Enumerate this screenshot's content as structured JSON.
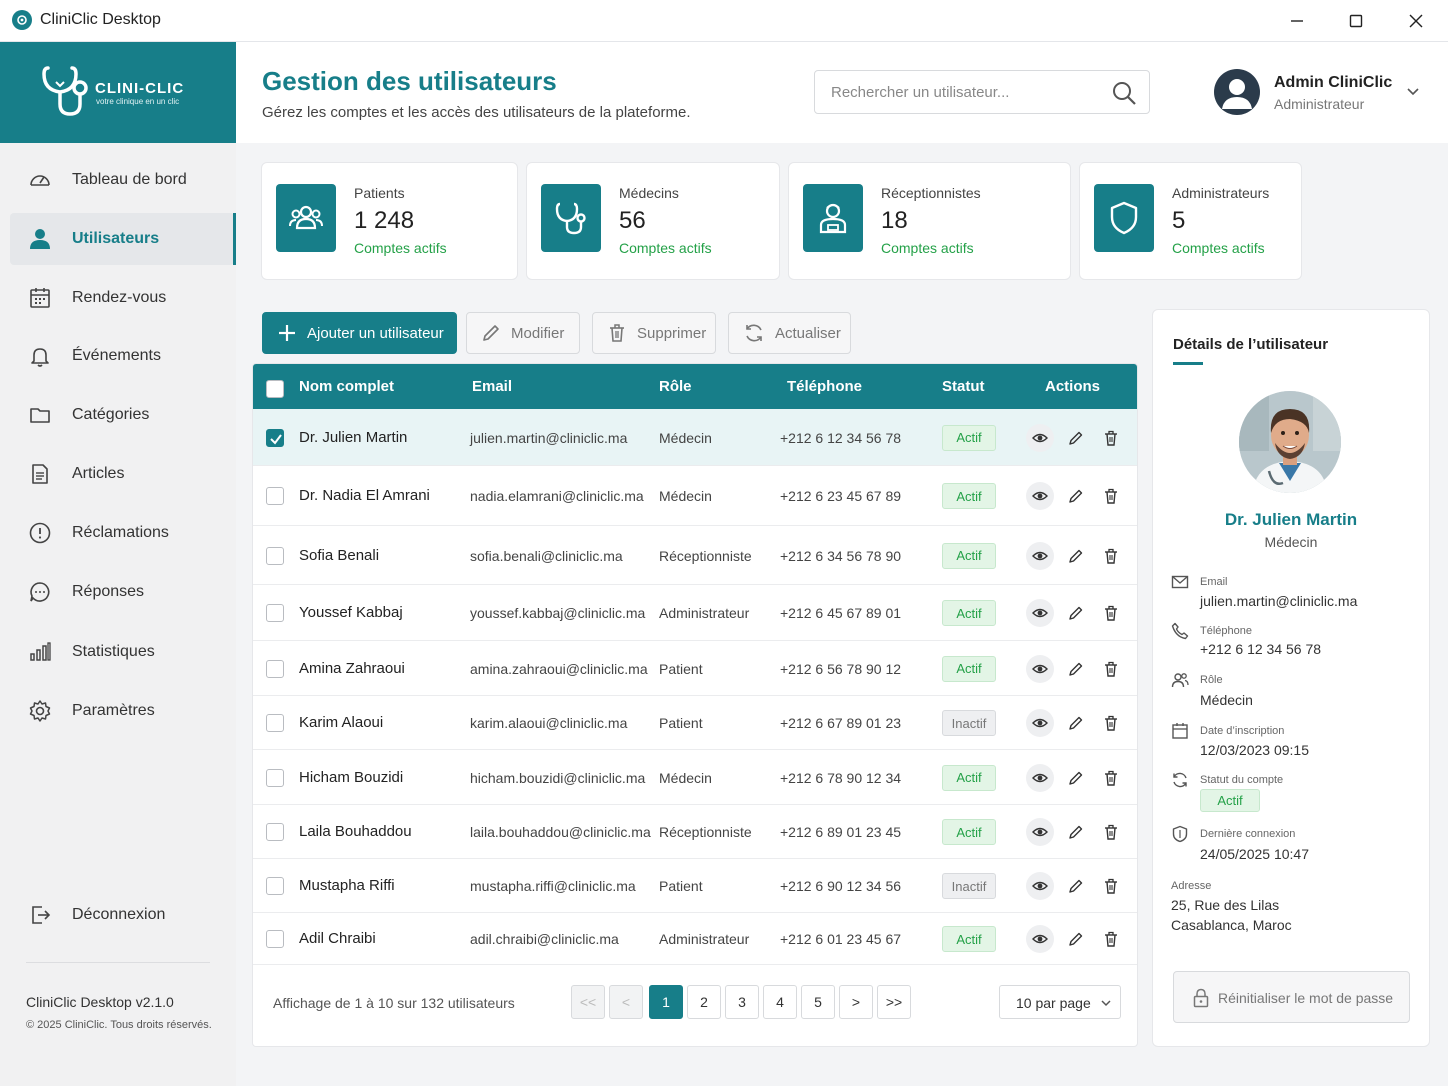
{
  "window": {
    "title": "CliniClic Desktop"
  },
  "brand": {
    "name": "CLINI-CLIC",
    "tagline": "votre clinique en un clic",
    "color": "#177e89"
  },
  "sidebar": {
    "items": [
      {
        "label": "Tableau de bord",
        "icon": "dashboard-icon"
      },
      {
        "label": "Utilisateurs",
        "icon": "user-icon",
        "active": true
      },
      {
        "label": "Rendez-vous",
        "icon": "calendar-icon"
      },
      {
        "label": "Événements",
        "icon": "bell-icon"
      },
      {
        "label": "Catégories",
        "icon": "folder-icon"
      },
      {
        "label": "Articles",
        "icon": "document-icon"
      },
      {
        "label": "Réclamations",
        "icon": "alert-circle-icon"
      },
      {
        "label": "Réponses",
        "icon": "chat-icon"
      },
      {
        "label": "Statistiques",
        "icon": "bar-chart-icon"
      },
      {
        "label": "Paramètres",
        "icon": "gear-icon"
      }
    ],
    "logout": "Déconnexion",
    "version": "CliniClic Desktop v2.1.0",
    "copyright": "© 2025 CliniClic. Tous droits réservés."
  },
  "header": {
    "title": "Gestion des utilisateurs",
    "subtitle": "Gérez les comptes et les accès des utilisateurs de la plateforme.",
    "search_placeholder": "Rechercher un utilisateur...",
    "user_name": "Admin CliniClic",
    "user_role": "Administrateur"
  },
  "stats": [
    {
      "label": "Patients",
      "value": "1 248",
      "sub": "Comptes actifs",
      "icon": "users-icon"
    },
    {
      "label": "Médecins",
      "value": "56",
      "sub": "Comptes actifs",
      "icon": "stethoscope-icon"
    },
    {
      "label": "Réceptionnistes",
      "value": "18",
      "sub": "Comptes actifs",
      "icon": "receptionist-icon"
    },
    {
      "label": "Administrateurs",
      "value": "5",
      "sub": "Comptes actifs",
      "icon": "shield-icon"
    }
  ],
  "toolbar": {
    "add": "Ajouter un utilisateur",
    "edit": "Modifier",
    "delete": "Supprimer",
    "refresh": "Actualiser"
  },
  "table": {
    "columns": [
      "Nom complet",
      "Email",
      "Rôle",
      "Téléphone",
      "Statut",
      "Actions"
    ],
    "rows": [
      {
        "name": "Dr. Julien Martin",
        "email": "julien.martin@cliniclic.ma",
        "role": "Médecin",
        "phone": "+212 6 12 34 56 78",
        "status": "Actif",
        "selected": true
      },
      {
        "name": "Dr. Nadia El Amrani",
        "email": "nadia.elamrani@cliniclic.ma",
        "role": "Médecin",
        "phone": "+212 6 23 45 67 89",
        "status": "Actif"
      },
      {
        "name": "Sofia Benali",
        "email": "sofia.benali@cliniclic.ma",
        "role": "Réceptionniste",
        "phone": "+212 6 34 56 78 90",
        "status": "Actif"
      },
      {
        "name": "Youssef Kabbaj",
        "email": "youssef.kabbaj@cliniclic.ma",
        "role": "Administrateur",
        "phone": "+212 6 45 67 89 01",
        "status": "Actif"
      },
      {
        "name": "Amina Zahraoui",
        "email": "amina.zahraoui@cliniclic.ma",
        "role": "Patient",
        "phone": "+212 6 56 78 90 12",
        "status": "Actif"
      },
      {
        "name": "Karim Alaoui",
        "email": "karim.alaoui@cliniclic.ma",
        "role": "Patient",
        "phone": "+212 6 67 89 01 23",
        "status": "Inactif"
      },
      {
        "name": "Hicham Bouzidi",
        "email": "hicham.bouzidi@cliniclic.ma",
        "role": "Médecin",
        "phone": "+212 6 78 90 12 34",
        "status": "Actif"
      },
      {
        "name": "Laila Bouhaddou",
        "email": "laila.bouhaddou@cliniclic.ma",
        "role": "Réceptionniste",
        "phone": "+212 6 89 01 23 45",
        "status": "Actif"
      },
      {
        "name": "Mustapha Riffi",
        "email": "mustapha.riffi@cliniclic.ma",
        "role": "Patient",
        "phone": "+212 6 90 12 34 56",
        "status": "Inactif"
      },
      {
        "name": "Adil Chraibi",
        "email": "adil.chraibi@cliniclic.ma",
        "role": "Administrateur",
        "phone": "+212 6 01 23 45 67",
        "status": "Actif"
      }
    ],
    "footer_info": "Affichage de 1 à 10 sur 132 utilisateurs",
    "pagination": [
      "<<",
      "<",
      "1",
      "2",
      "3",
      "4",
      "5",
      ">",
      ">>"
    ],
    "current_page": "1",
    "per_page": "10 par page"
  },
  "details": {
    "title": "Détails de l’utilisateur",
    "name": "Dr. Julien Martin",
    "role": "Médecin",
    "fields": [
      {
        "label": "Email",
        "value": "julien.martin@cliniclic.ma",
        "icon": "mail-icon"
      },
      {
        "label": "Téléphone",
        "value": "+212 6 12 34 56 78",
        "icon": "phone-icon"
      },
      {
        "label": "Rôle",
        "value": "Médecin",
        "icon": "users-icon"
      },
      {
        "label": "Date d’inscription",
        "value": "12/03/2023 09:15",
        "icon": "calendar-icon"
      },
      {
        "label": "Statut du compte",
        "value": "",
        "icon": "refresh-icon"
      },
      {
        "label": "Dernière connexion",
        "value": "24/05/2025 10:47",
        "icon": "shield-icon"
      }
    ],
    "status": "Actif",
    "address_label": "Adresse",
    "address_line1": "25, Rue des Lilas",
    "address_line2": "Casablanca, Maroc",
    "reset_label": "Réinitialiser le mot de passe"
  }
}
